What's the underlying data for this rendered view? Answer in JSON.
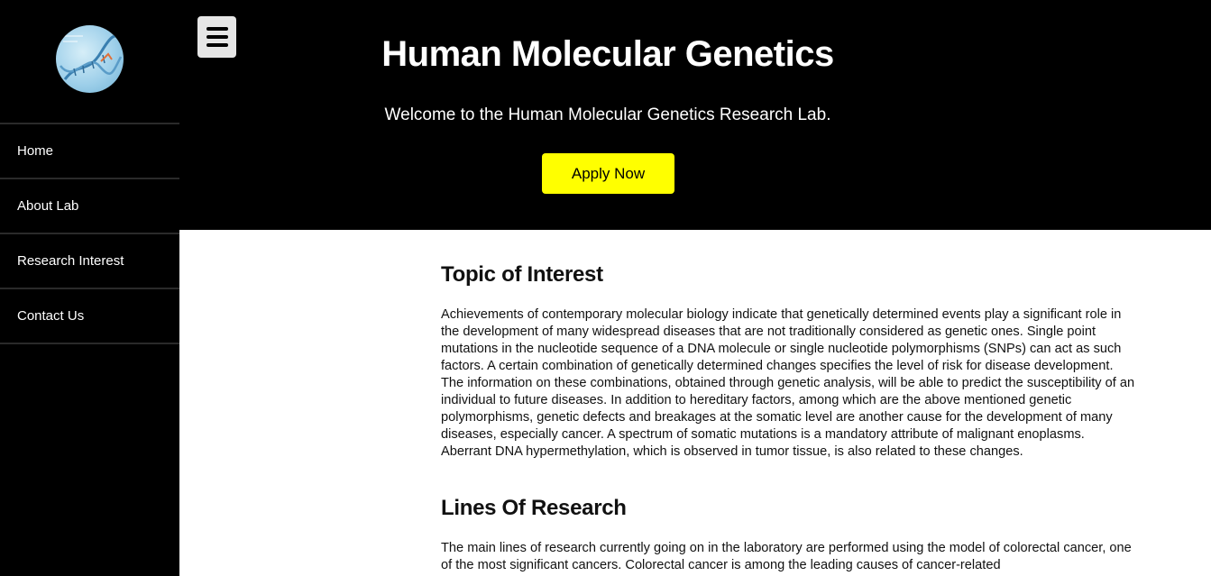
{
  "sidebar": {
    "logo": {
      "icon": "dna-logo-icon"
    },
    "nav_items": [
      {
        "label": "Home"
      },
      {
        "label": "About Lab"
      },
      {
        "label": "Research Interest"
      },
      {
        "label": "Contact Us"
      }
    ]
  },
  "header": {
    "menu_icon": "hamburger-menu-icon",
    "title": "Human Molecular Genetics",
    "subtitle": "Welcome to the Human Molecular Genetics Research Lab.",
    "apply_label": "Apply Now",
    "apply_color": "#ffff00"
  },
  "main": {
    "sections": [
      {
        "heading": "Topic of Interest",
        "body": "Achievements of contemporary molecular biology indicate that genetically determined events play a significant role in the development of many widespread diseases that are not traditionally considered as genetic ones. Single point mutations in the nucleotide sequence of a DNA molecule or single nucleotide polymorphisms (SNPs) can act as such factors. A certain combination of genetically determined changes specifies the level of risk for disease development. The information on these combinations, obtained through genetic analysis, will be able to predict the susceptibility of an individual to future diseases. In addition to hereditary factors, among which are the above mentioned genetic polymorphisms, genetic defects and breakages at the somatic level are another cause for the development of many diseases, especially cancer. A spectrum of somatic mutations is a mandatory attribute of malignant enoplasms. Aberrant DNA hypermethylation, which is observed in tumor tissue, is also related to these changes."
      },
      {
        "heading": "Lines Of Research",
        "body": "The main lines of research currently going on in the laboratory are performed using the model of colorectal cancer, one of the most significant cancers. Colorectal cancer is among the leading causes of cancer-related"
      }
    ]
  }
}
